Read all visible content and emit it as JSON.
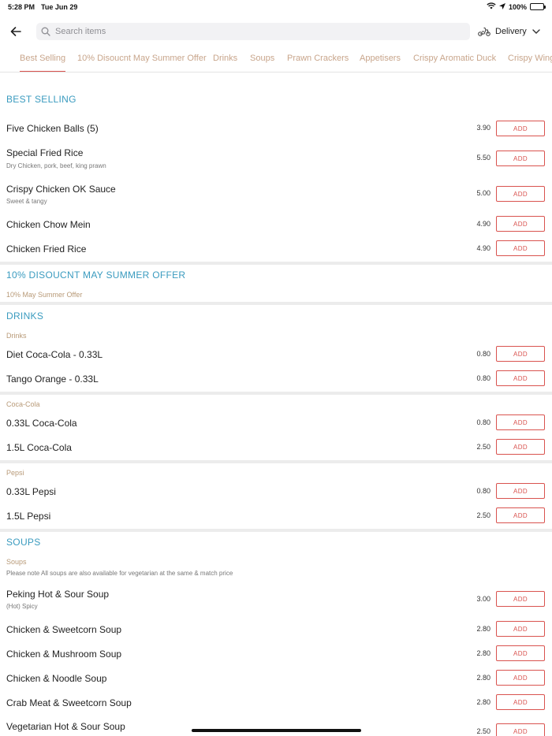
{
  "status_bar": {
    "time": "5:28 PM",
    "date": "Tue Jun 29",
    "battery": "100%"
  },
  "header": {
    "search_placeholder": "Search items",
    "delivery_label": "Delivery"
  },
  "tabs": [
    {
      "label": "Best Selling",
      "active": true
    },
    {
      "label": "10% Disoucnt May Summer Offer"
    },
    {
      "label": "Drinks"
    },
    {
      "label": "Soups"
    },
    {
      "label": "Prawn Crackers"
    },
    {
      "label": "Appetisers"
    },
    {
      "label": "Crispy Aromatic Duck"
    },
    {
      "label": "Crispy Wing"
    }
  ],
  "add_label": "ADD",
  "best_selling": {
    "title": "BEST SELLING",
    "items": [
      {
        "name": "Five Chicken Balls (5)",
        "price": "3.90"
      },
      {
        "name": "Special Fried Rice",
        "desc": "Dry  Chicken, pork, beef, king prawn",
        "price": "5.50"
      },
      {
        "name": "Crispy Chicken OK Sauce",
        "desc": "Sweet & tangy",
        "price": "5.00"
      },
      {
        "name": "Chicken Chow Mein",
        "price": "4.90"
      },
      {
        "name": "Chicken Fried Rice",
        "price": "4.90"
      }
    ]
  },
  "summer_offer": {
    "title": "10% DISOUCNT MAY SUMMER OFFER",
    "sub": "10% May Summer Offer"
  },
  "drinks": {
    "title": "DRINKS",
    "groups": [
      {
        "label": "Drinks",
        "items": [
          {
            "name": "Diet Coca-Cola - 0.33L",
            "price": "0.80"
          },
          {
            "name": "Tango Orange - 0.33L",
            "price": "0.80"
          }
        ]
      },
      {
        "label": "Coca-Cola",
        "items": [
          {
            "name": "0.33L Coca-Cola",
            "price": "0.80"
          },
          {
            "name": "1.5L Coca-Cola",
            "price": "2.50"
          }
        ]
      },
      {
        "label": "Pepsi",
        "items": [
          {
            "name": "0.33L Pepsi",
            "price": "0.80"
          },
          {
            "name": "1.5L Pepsi",
            "price": "2.50"
          }
        ]
      }
    ]
  },
  "soups": {
    "title": "SOUPS",
    "sub": "Soups",
    "note": "Please note All soups are also available for vegetarian at the same & match price",
    "items": [
      {
        "name": "Peking Hot & Sour Soup",
        "desc": "(Hot) Spicy",
        "price": "3.00"
      },
      {
        "name": "Chicken & Sweetcorn Soup",
        "price": "2.80"
      },
      {
        "name": "Chicken & Mushroom Soup",
        "price": "2.80"
      },
      {
        "name": "Chicken & Noodle Soup",
        "price": "2.80"
      },
      {
        "name": "Crab Meat & Sweetcorn Soup",
        "price": "2.80"
      },
      {
        "name": "Vegetarian Hot & Sour Soup",
        "price": "2.50"
      }
    ]
  }
}
